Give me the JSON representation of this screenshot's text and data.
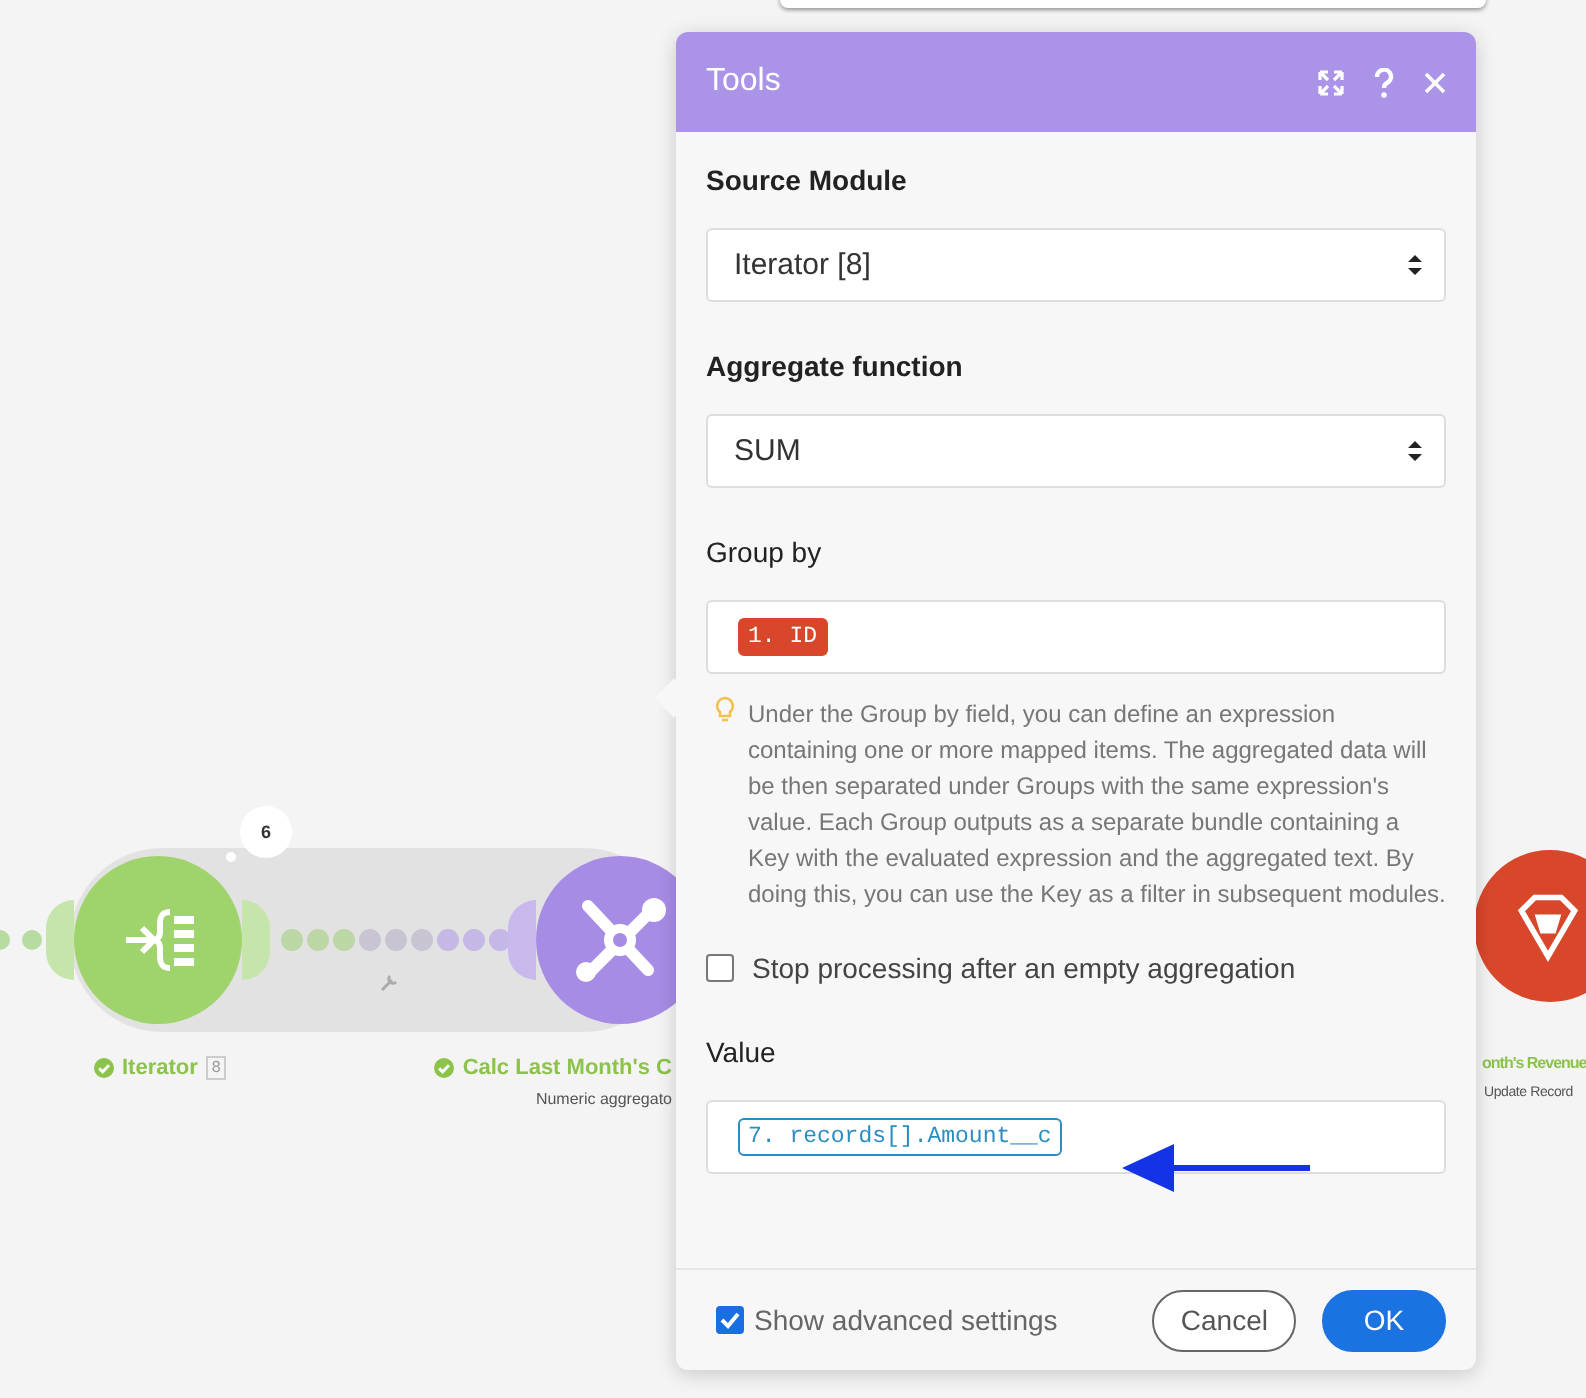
{
  "canvas": {
    "modules": [
      {
        "kind": "iterator",
        "label": "Iterator",
        "badge": "8",
        "bubble": "6"
      },
      {
        "kind": "tools",
        "label": "Calc Last Month's C",
        "sublabel": "Numeric aggregato"
      },
      {
        "kind": "record",
        "label": "onth's Revenue",
        "sublabel": "Update Record"
      }
    ]
  },
  "dialog": {
    "title": "Tools",
    "fields": [
      {
        "kind": "select",
        "label": "Source Module",
        "value": "Iterator [8]"
      },
      {
        "kind": "select",
        "label": "Aggregate function",
        "value": "SUM"
      },
      {
        "kind": "mapped",
        "label": "Group by",
        "tag": {
          "text": "1. ID",
          "kind": "filled"
        },
        "hint": "Under the Group by field, you can define an expression containing one or more mapped items. The aggregated data will be then separated under Groups with the same expression's value. Each Group outputs as a separate bundle containing a Key with the evaluated expression and the aggregated text. By doing this, you can use the Key as a filter in subsequent modules."
      },
      {
        "kind": "checkbox",
        "label": "Stop processing after an empty aggregation",
        "checked": false
      },
      {
        "kind": "mapped",
        "label": "Value",
        "tag": {
          "text": "7. records[].Amount__c",
          "kind": "outlined"
        }
      }
    ],
    "advanced": {
      "label": "Show advanced settings",
      "checked": true
    },
    "buttons": [
      {
        "label": "Cancel",
        "kind": "secondary"
      },
      {
        "label": "OK",
        "kind": "primary"
      }
    ]
  }
}
